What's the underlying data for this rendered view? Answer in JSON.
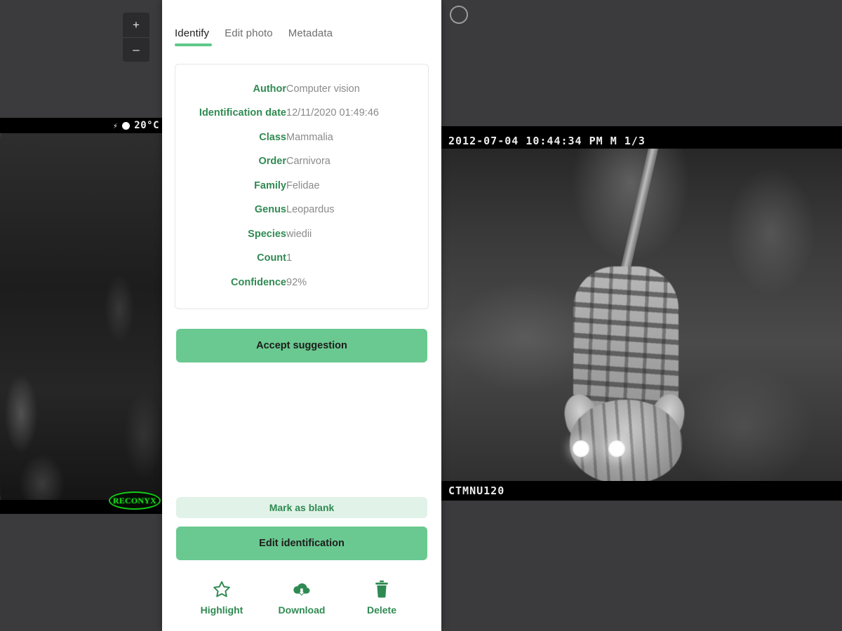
{
  "app": {
    "background_color": "#3b3b3d",
    "accent_green": "#6ac990",
    "label_green": "#2f8a52",
    "soft_green": "#e1f2e8"
  },
  "left_viewer": {
    "zoom_in_label": "+",
    "zoom_out_label": "–",
    "photo": {
      "temperature": "20°C",
      "flash_icon": "lightning-bolt-icon",
      "moon_icon": "moon-phase-icon",
      "brand": "RECONYX"
    }
  },
  "right_viewer": {
    "shutter_icon": "camera-shutter-circle-icon",
    "photo": {
      "timestamp": "2012-07-04 10:44:34 PM   M 1/3",
      "camera_id": "CTMNU120"
    }
  },
  "panel": {
    "tabs": [
      {
        "label": "Identify",
        "active": true
      },
      {
        "label": "Edit photo",
        "active": false
      },
      {
        "label": "Metadata",
        "active": false
      }
    ],
    "identification": {
      "rows": [
        {
          "key": "Author",
          "value": "Computer vision"
        },
        {
          "key": "Identification date",
          "value": "12/11/2020 01:49:46"
        },
        {
          "key": "Class",
          "value": "Mammalia"
        },
        {
          "key": "Order",
          "value": "Carnivora"
        },
        {
          "key": "Family",
          "value": "Felidae"
        },
        {
          "key": "Genus",
          "value": "Leopardus"
        },
        {
          "key": "Species",
          "value": "wiedii"
        },
        {
          "key": "Count",
          "value": "1"
        },
        {
          "key": "Confidence",
          "value": "92%"
        }
      ]
    },
    "buttons": {
      "accept": "Accept suggestion",
      "mark_blank": "Mark as blank",
      "edit_identification": "Edit identification"
    },
    "actions": [
      {
        "label": "Highlight",
        "icon": "star-outline-icon"
      },
      {
        "label": "Download",
        "icon": "cloud-download-icon"
      },
      {
        "label": "Delete",
        "icon": "trash-icon"
      }
    ]
  }
}
